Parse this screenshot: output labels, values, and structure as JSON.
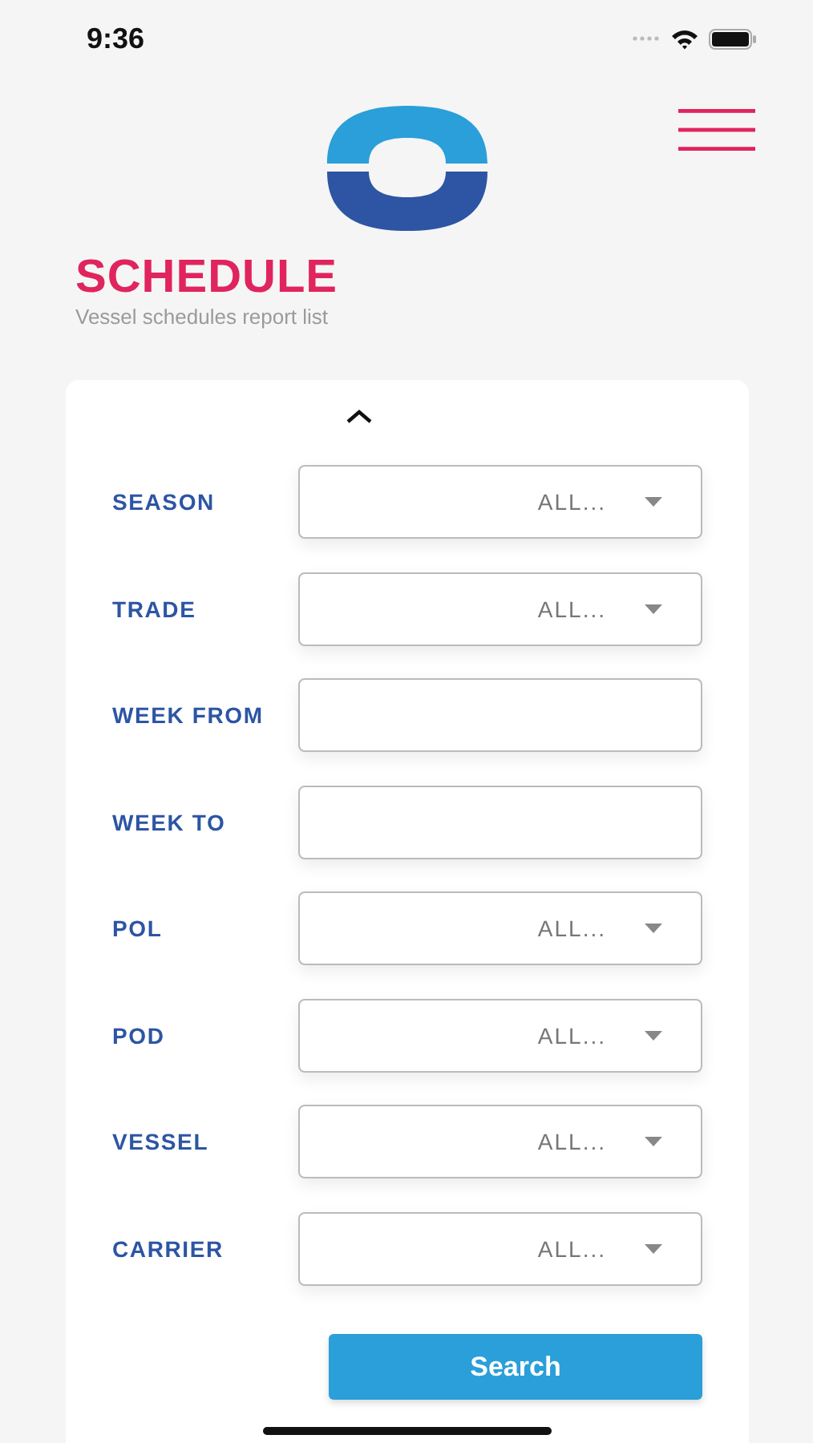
{
  "status_bar": {
    "time": "9:36"
  },
  "header": {
    "title": "SCHEDULE",
    "subtitle": "Vessel schedules report list"
  },
  "filters": [
    {
      "label": "SEASON",
      "kind": "select",
      "value": "ALL..."
    },
    {
      "label": "TRADE",
      "kind": "select",
      "value": "ALL..."
    },
    {
      "label": "WEEK FROM",
      "kind": "text"
    },
    {
      "label": "WEEK TO",
      "kind": "text"
    },
    {
      "label": "POL",
      "kind": "select",
      "value": "ALL..."
    },
    {
      "label": "POD",
      "kind": "select",
      "value": "ALL..."
    },
    {
      "label": "VESSEL",
      "kind": "select",
      "value": "ALL..."
    },
    {
      "label": "CARRIER",
      "kind": "select",
      "value": "ALL..."
    }
  ],
  "search_button": "Search"
}
